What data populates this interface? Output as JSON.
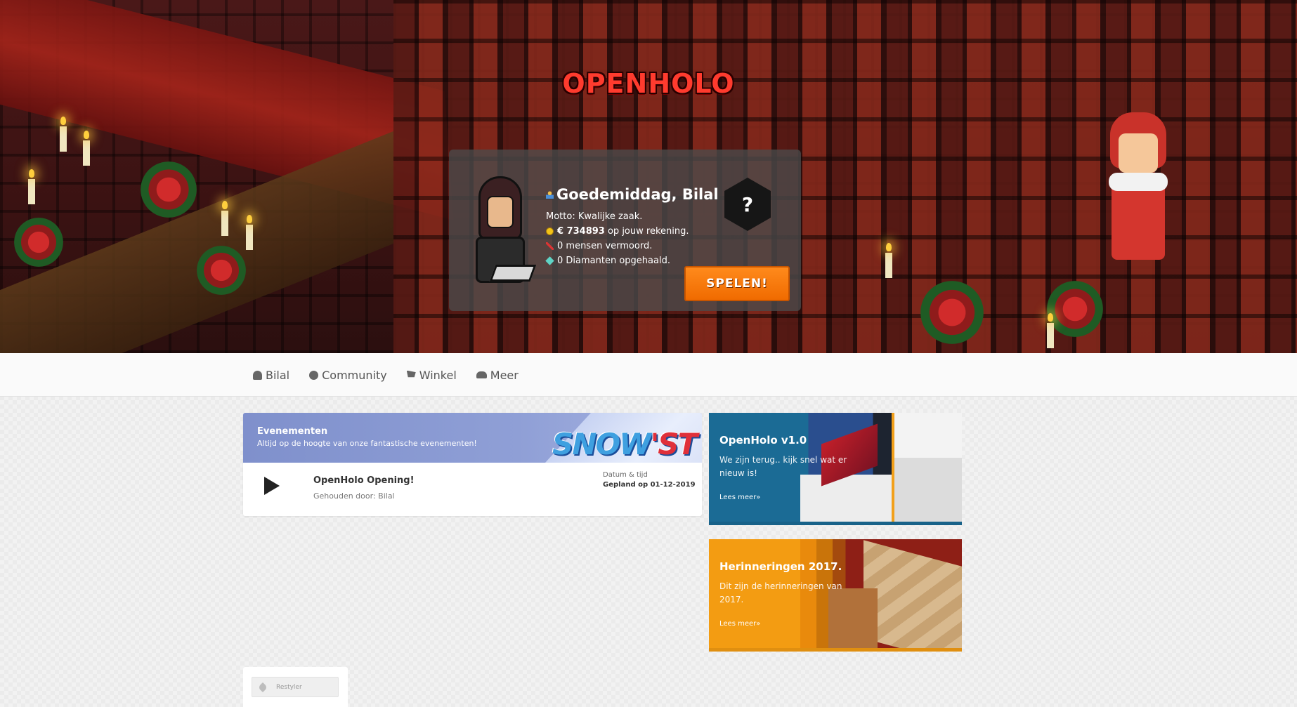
{
  "hero": {
    "logo": "OPENHOLO"
  },
  "welcome": {
    "greeting": "Goedemiddag, Bilal",
    "motto": "Motto: Kwalijke zaak.",
    "money_amount": "€ 734893",
    "money_suffix": " op jouw rekening.",
    "kills": "0 mensen vermoord.",
    "diamonds": "0 Diamanten opgehaald.",
    "badge_symbol": "?",
    "play_label": "SPELEN!"
  },
  "nav": {
    "items": [
      {
        "label": "Bilal",
        "icon": "user-icon"
      },
      {
        "label": "Community",
        "icon": "globe-icon"
      },
      {
        "label": "Winkel",
        "icon": "shopping-cart-icon"
      },
      {
        "label": "Meer",
        "icon": "cloud-icon"
      }
    ]
  },
  "events": {
    "title": "Evenementen",
    "subtitle": "Altijd op de hoogte van onze fantastische evenementen!",
    "banner_text_a": "SNOW",
    "banner_text_b": "'ST",
    "items": [
      {
        "name": "OpenHolo Opening!",
        "host": "Gehouden door: Bilal",
        "date_label": "Datum & tijd",
        "date": "Gepland op 01-12-2019"
      }
    ]
  },
  "news": [
    {
      "title": "OpenHolo v1.0",
      "text": "We zijn terug.. kijk snel wat er nieuw is!",
      "link": "Lees meer»",
      "color": "#1b6b95"
    },
    {
      "title": "Herinneringen 2017.",
      "text": "Dit zijn de herinneringen van 2017.",
      "link": "Lees meer»",
      "color": "#f39c12"
    }
  ],
  "restyler": {
    "label": "Restyler"
  },
  "colors": {
    "accent_orange": "#f47a0c",
    "logo_red": "#ff3b2e",
    "events_header": "#8f9fd6"
  }
}
